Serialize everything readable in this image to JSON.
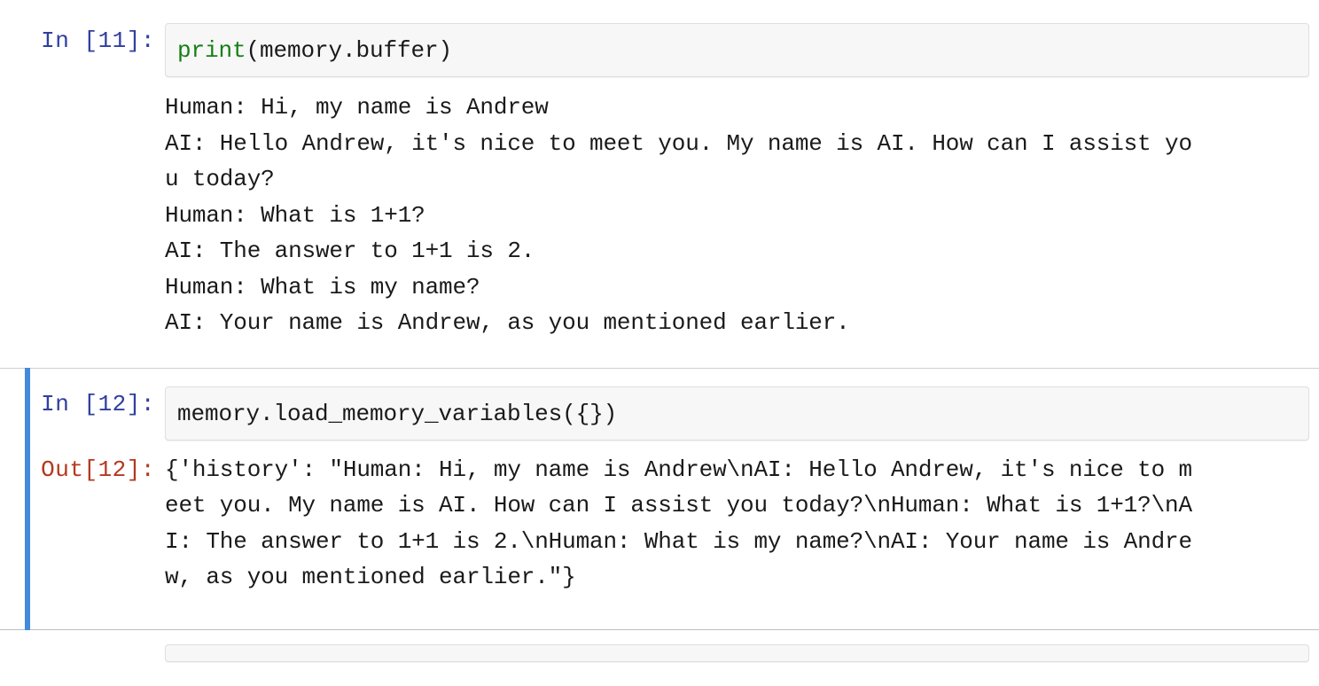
{
  "notebook": {
    "cells": [
      {
        "id": "cell-print-buffer",
        "selected": false,
        "input_prompt": "In [11]:",
        "code_tokens": [
          {
            "text": "print",
            "type": "builtin"
          },
          {
            "text": "(memory.buffer)",
            "type": "plain"
          }
        ],
        "code_plain": "print(memory.buffer)",
        "output_type": "stream",
        "output_text": "Human: Hi, my name is Andrew\nAI: Hello Andrew, it's nice to meet you. My name is AI. How can I assist you today?\nHuman: What is 1+1?\nAI: The answer to 1+1 is 2.\nHuman: What is my name?\nAI: Your name is Andrew, as you mentioned earlier."
      },
      {
        "id": "cell-load-memory-variables",
        "selected": true,
        "input_prompt": "In [12]:",
        "code_tokens": [
          {
            "text": "memory.load_memory_variables({})",
            "type": "plain"
          }
        ],
        "code_plain": "memory.load_memory_variables({})",
        "output_type": "execute_result",
        "output_prompt": "Out[12]:",
        "output_text": "{'history': \"Human: Hi, my name is Andrew\\nAI: Hello Andrew, it's nice to meet you. My name is AI. How can I assist you today?\\nHuman: What is 1+1?\\nAI: The answer to 1+1 is 2.\\nHuman: What is my name?\\nAI: Your name is Andrew, as you mentioned earlier.\"}"
      },
      {
        "id": "cell-next-partial",
        "selected": false,
        "input_prompt": "",
        "code_plain": ""
      }
    ]
  },
  "colors": {
    "in_prompt": "#303f9f",
    "out_prompt": "#b5381f",
    "selection_bar": "#428bdc",
    "input_background": "#f7f7f7",
    "input_border": "#dfdfdf",
    "builtin_token": "#157f15",
    "text": "#1a1a1a",
    "page_background": "#ffffff"
  }
}
